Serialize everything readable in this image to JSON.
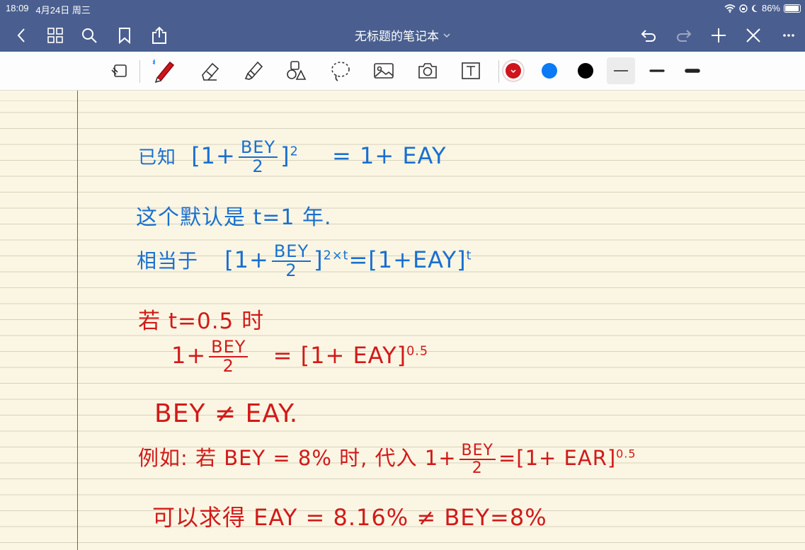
{
  "status_bar": {
    "time": "18:09",
    "date": "4月24日 周三",
    "battery": "86%"
  },
  "nav": {
    "title": "无标题的笔记本",
    "back_icon": "chevron-left-icon",
    "grid_icon": "grid-icon",
    "search_icon": "search-icon",
    "bookmark_icon": "bookmark-icon",
    "share_icon": "share-icon",
    "undo_icon": "undo-icon",
    "redo_icon": "redo-icon",
    "add_icon": "plus-icon",
    "close_icon": "close-icon",
    "more_icon": "more-icon"
  },
  "toolbar": {
    "tools": [
      "read-mode-icon",
      "pen-icon",
      "eraser-icon",
      "highlighter-icon",
      "shapes-icon",
      "lasso-icon",
      "image-icon",
      "camera-icon",
      "text-icon"
    ],
    "colors": [
      "#d0141b",
      "#0a7af5",
      "#000000"
    ],
    "text_tool_label": "T"
  },
  "note": {
    "line1_prefix": "已知",
    "line1_lb": "[1+",
    "line1_num": "BEY",
    "line1_den": "2",
    "line1_rb": "]",
    "line1_exp": "2",
    "line1_rhs": "= 1+ EAY",
    "line2": "这个默认是 t=1 年.",
    "line3_prefix": "相当于",
    "line3_lb": "[1+",
    "line3_num": "BEY",
    "line3_den": "2",
    "line3_rb": "]",
    "line3_exp": "2×t",
    "line3_rhs": "=[1+EAY]",
    "line3_rhs_exp": "t",
    "line4": "若 t=0.5 时",
    "line5_lhs": "1+",
    "line5_num": "BEY",
    "line5_den": "2",
    "line5_rhs": "= [1+ EAY]",
    "line5_exp": "0.5",
    "line6": "BEY ≠ EAY.",
    "line7_text": "例如: 若 BEY = 8% 时, 代入 1+",
    "line7_num": "BEY",
    "line7_den": "2",
    "line7_rhs": "=[1+ EAR]",
    "line7_exp": "0.5",
    "line8": "可以求得 EAY = 8.16% ≠ BEY=8%"
  }
}
